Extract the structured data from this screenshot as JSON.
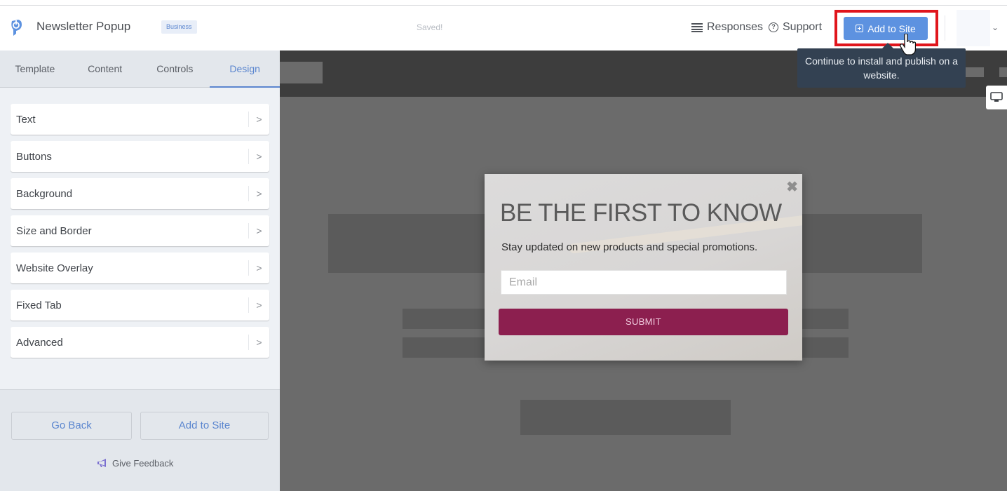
{
  "header": {
    "app_title": "Newsletter Popup",
    "plan_badge": "Business",
    "save_status": "Saved!",
    "responses_label": "Responses",
    "support_label": "Support",
    "add_to_site_label": "Add to Site",
    "icons": {
      "logo": "power-logo-icon",
      "responses": "list-icon",
      "support": "help-circle-icon",
      "add_to_site": "plus-square-icon",
      "account_menu": "chevron-down-icon"
    },
    "account_chevron": "⌄"
  },
  "tooltip": {
    "text": "Continue to install and publish on a website."
  },
  "sidebar": {
    "tabs": [
      {
        "label": "Template",
        "active": false
      },
      {
        "label": "Content",
        "active": false
      },
      {
        "label": "Controls",
        "active": false
      },
      {
        "label": "Design",
        "active": true
      }
    ],
    "menu_items": [
      {
        "label": "Text"
      },
      {
        "label": "Buttons"
      },
      {
        "label": "Background"
      },
      {
        "label": "Size and Border"
      },
      {
        "label": "Website Overlay"
      },
      {
        "label": "Fixed Tab"
      },
      {
        "label": "Advanced"
      }
    ],
    "chevron_glyph": ">",
    "footer": {
      "go_back_label": "Go Back",
      "add_to_site_label": "Add to Site",
      "feedback_label": "Give Feedback"
    }
  },
  "popup": {
    "title": "BE THE FIRST TO KNOW",
    "subtitle": "Stay updated on new products and special promotions.",
    "email_placeholder": "Email",
    "submit_label": "SUBMIT",
    "close_glyph": "✖"
  },
  "colors": {
    "accent": "#5d92e0",
    "highlight": "#e0151c",
    "submit": "#8c1f4f",
    "tooltip": "#334152"
  }
}
